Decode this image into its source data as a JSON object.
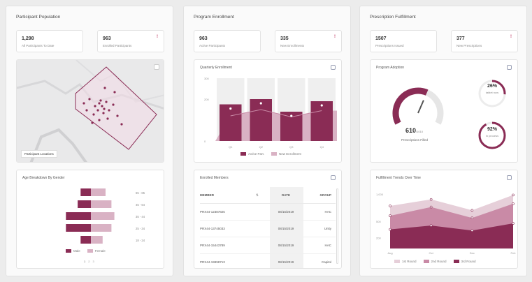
{
  "colors": {
    "accent": "#8a2c55",
    "accent_light": "#d9b2c4",
    "muted": "#bfbfbf"
  },
  "col1": {
    "title": "Participant Population",
    "kpi1": {
      "value": "1,298",
      "label": "All Participants To Date"
    },
    "kpi2": {
      "value": "963",
      "label": "Enrolled Participants",
      "flag": "!"
    },
    "map": {
      "label": "Participant Locations",
      "expand_icon": "expand-icon"
    },
    "age_chart": {
      "title": "Age Breakdown By Gender",
      "age_labels": [
        "65 - 85",
        "45 - 64",
        "35 - 44",
        "25 - 34",
        "18 - 24"
      ],
      "male": [
        0.35,
        0.45,
        0.85,
        0.85,
        0.35
      ],
      "female": [
        0.5,
        0.7,
        0.8,
        0.7,
        0.4
      ],
      "legend": [
        "Male",
        "Female"
      ],
      "pager": [
        "1",
        "2",
        "3"
      ]
    }
  },
  "col2": {
    "title": "Program Enrollment",
    "kpi1": {
      "value": "963",
      "label": "Active Participants"
    },
    "kpi2": {
      "value": "335",
      "label": "New Enrollments",
      "flag": "!"
    },
    "chart": {
      "title": "Quarterly Enrollment",
      "action_icon": "menu-icon",
      "ticks": [
        "300",
        "200",
        "0"
      ],
      "categories": [
        "Q1",
        "Q2",
        "Q3",
        "Q4"
      ],
      "active": [
        175,
        200,
        140,
        190
      ],
      "new_enroll": [
        120,
        150,
        115,
        145
      ],
      "background": [
        300,
        300,
        300,
        300
      ],
      "legend": [
        "Active Part.",
        "New Enrollment"
      ]
    },
    "table": {
      "title": "Enrolled Members",
      "headers": [
        "MEMBER",
        "DATE",
        "GROUP"
      ],
      "rows": [
        {
          "member": "PRX44-12387825",
          "date": "08/15/2019",
          "group": "HAC"
        },
        {
          "member": "PRX44-13745033",
          "date": "08/15/2019",
          "group": "Unity"
        },
        {
          "member": "PRX44-15443789",
          "date": "08/15/2019",
          "group": "HAC"
        },
        {
          "member": "PRX44-19998713",
          "date": "08/15/2019",
          "group": "Capitol"
        }
      ]
    }
  },
  "col3": {
    "title": "Prescription Fulfillment",
    "kpi1": {
      "value": "1507",
      "label": "Prescriptions Issued"
    },
    "kpi2": {
      "value": "377",
      "label": "New Prescriptions",
      "flag": "!"
    },
    "gauge": {
      "title": "Program Adoption",
      "value": "610",
      "value_suffix": "/1010",
      "sublabel": "Prescriptions Filled",
      "fraction": 0.6,
      "ring1": {
        "pct": "26%",
        "label": "tablet now",
        "fraction": 0.26
      },
      "ring2": {
        "pct": "92%",
        "label": "in process",
        "fraction": 0.92
      }
    },
    "trend": {
      "title": "Fulfillment Trends Over Time",
      "ticks": [
        "1,000",
        "500",
        "200"
      ],
      "categories": [
        "Aug",
        "Oct",
        "Dec",
        "Feb"
      ],
      "series_a": [
        780,
        900,
        700,
        980
      ],
      "series_b": [
        600,
        760,
        560,
        820
      ],
      "series_c": [
        350,
        420,
        330,
        460
      ],
      "legend": [
        "1st Round",
        "2nd Round",
        "3rd Round"
      ]
    }
  }
}
